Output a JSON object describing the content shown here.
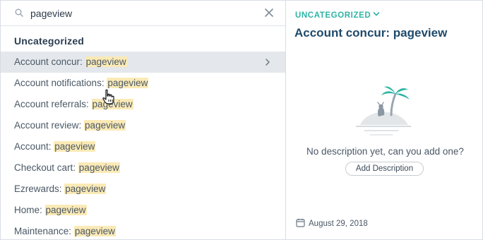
{
  "search": {
    "value": "pageview"
  },
  "list": {
    "group_title": "Uncategorized",
    "items": [
      {
        "prefix": "Account concur: ",
        "highlight": "pageview"
      },
      {
        "prefix": "Account notifications: ",
        "highlight": "pageview"
      },
      {
        "prefix": "Account referrals: ",
        "highlight": "pageview"
      },
      {
        "prefix": "Account review: ",
        "highlight": "pageview"
      },
      {
        "prefix": "Account: ",
        "highlight": "pageview"
      },
      {
        "prefix": "Checkout cart: ",
        "highlight": "pageview"
      },
      {
        "prefix": "Ezrewards: ",
        "highlight": "pageview"
      },
      {
        "prefix": "Home: ",
        "highlight": "pageview"
      },
      {
        "prefix": "Maintenance: ",
        "highlight": "pageview"
      }
    ]
  },
  "detail": {
    "category": "UNCATEGORIZED",
    "title": "Account concur: pageview",
    "empty_message": "No description yet, can you add one?",
    "add_button": "Add Description",
    "date": "August 29, 2018"
  },
  "icons": {
    "search": "search-icon",
    "clear": "close-icon",
    "chevron": "chevron-right-icon",
    "caret": "chevron-down-icon",
    "calendar": "calendar-icon",
    "illustration": "island-palm-illustration",
    "cursor": "hand-pointer-cursor"
  },
  "colors": {
    "accent": "#2fb4a5",
    "title": "#1f4a6a",
    "highlight": "#fbeab6",
    "selected_row": "#e4e8ec"
  }
}
